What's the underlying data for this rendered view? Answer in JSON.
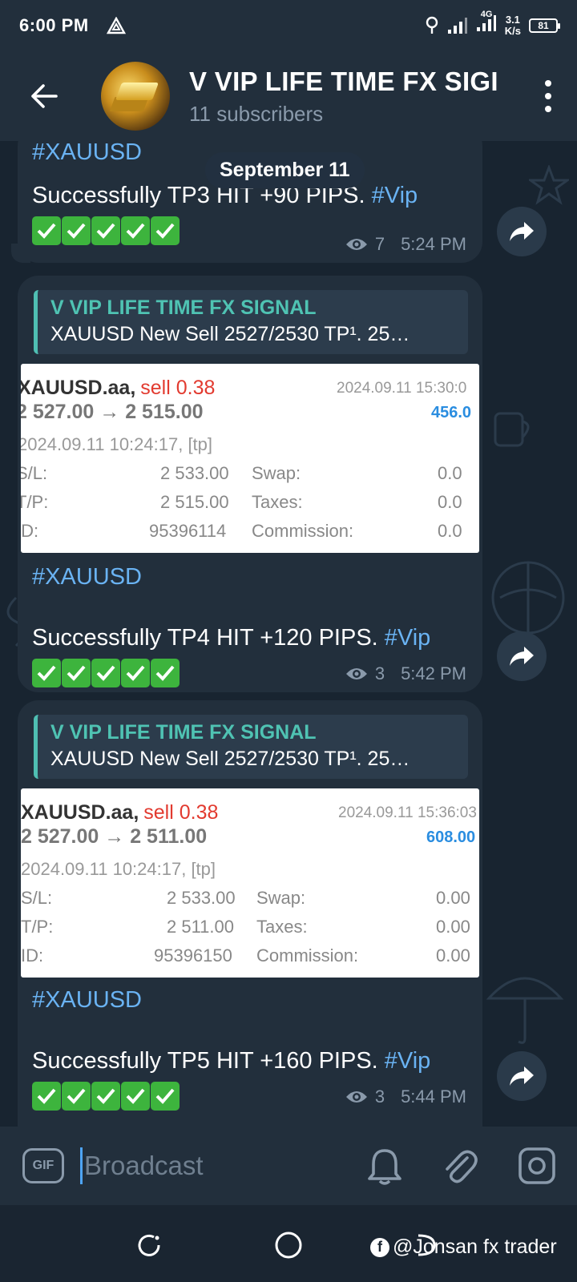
{
  "status_bar": {
    "time": "6:00 PM",
    "net_speed_top": "3.1",
    "net_speed_bottom": "K/s",
    "network": "4G",
    "battery": "81"
  },
  "header": {
    "title": "V VIP LIFE TIME FX SIGI",
    "subscribers": "11 subscribers"
  },
  "chat": {
    "date_chip": "September 11",
    "messages": [
      {
        "hashtag": "#XAUUSD",
        "text": "Successfully TP3 HIT +90 PIPS. ",
        "tag": "#Vip",
        "views": "7",
        "time": "5:24 PM"
      },
      {
        "reply_title": "V VIP LIFE TIME FX SIGNAL",
        "reply_text": "XAUUSD New Sell 2527/2530  TP¹. 25…",
        "shot": {
          "symbol": "XAUUSD.aa,",
          "side": "sell 0.38",
          "close_time": "2024.09.11 15:30:0",
          "prices": "2 527.00 → 2 515.00",
          "profit": "456.0",
          "open_time": "2024.09.11 10:24:17, [tp]",
          "sl_label": "S/L:",
          "sl": "2 533.00",
          "swap_label": "Swap:",
          "swap": "0.0",
          "tp_label": "T/P:",
          "tp": "2 515.00",
          "taxes_label": "Taxes:",
          "taxes": "0.0",
          "id_label": "ID:",
          "id": "95396114",
          "commission_label": "Commission:",
          "commission": "0.0"
        },
        "hashtag": "#XAUUSD",
        "text": "Successfully TP4 HIT +120 PIPS. ",
        "tag": "#Vip",
        "views": "3",
        "time": "5:42 PM"
      },
      {
        "reply_title": "V VIP LIFE TIME FX SIGNAL",
        "reply_text": "XAUUSD New Sell 2527/2530  TP¹. 25…",
        "shot": {
          "symbol": "XAUUSD.aa,",
          "side": "sell 0.38",
          "close_time": "2024.09.11 15:36:03",
          "prices": "2 527.00 → 2 511.00",
          "profit": "608.00",
          "open_time": "2024.09.11 10:24:17, [tp]",
          "sl_label": "S/L:",
          "sl": "2 533.00",
          "swap_label": "Swap:",
          "swap": "0.00",
          "tp_label": "T/P:",
          "tp": "2 511.00",
          "taxes_label": "Taxes:",
          "taxes": "0.00",
          "id_label": "ID:",
          "id": "95396150",
          "commission_label": "Commission:",
          "commission": "0.00"
        },
        "hashtag": "#XAUUSD",
        "text": "Successfully TP5 HIT +160 PIPS. ",
        "tag": "#Vip",
        "views": "3",
        "time": "5:44 PM"
      }
    ]
  },
  "input": {
    "gif_label": "GIF",
    "placeholder": "Broadcast"
  },
  "watermark": {
    "fb_glyph": "f",
    "text": "@Jonsan fx trader"
  }
}
